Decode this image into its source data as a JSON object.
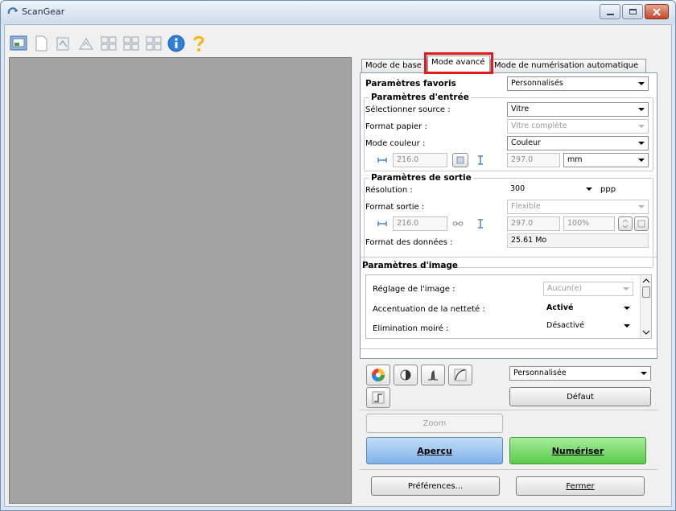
{
  "window": {
    "title": "ScanGear"
  },
  "tabs": [
    {
      "label": "Mode de base"
    },
    {
      "label": "Mode avancé"
    },
    {
      "label": "Mode de numérisation automatique"
    }
  ],
  "favorites": {
    "label": "Paramètres favoris",
    "value": "Personnalisés"
  },
  "input": {
    "section": "Paramètres d'entrée",
    "source_label": "Sélectionner source :",
    "source_value": "Vitre",
    "paper_label": "Format papier :",
    "paper_value": "Vitre complète",
    "color_label": "Mode couleur :",
    "color_value": "Couleur",
    "width": "216.0",
    "height": "297.0",
    "unit": "mm"
  },
  "output": {
    "section": "Paramètres de sortie",
    "resolution_label": "Résolution :",
    "resolution_value": "300",
    "resolution_unit": "ppp",
    "size_label": "Format sortie :",
    "size_value": "Flexible",
    "width": "216.0",
    "height": "297.0",
    "scale": "100%",
    "data_label": "Format des données :",
    "data_value": "25.61 Mo"
  },
  "image": {
    "section": "Paramètres d'image",
    "adjust_label": "Réglage de l'image :",
    "adjust_value": "Aucun(e)",
    "sharpen_label": "Accentuation de la netteté :",
    "sharpen_value": "Activé",
    "moire_label": "Elimination moiré :",
    "moire_value": "Désactivé"
  },
  "tone": {
    "preset": "Personnalisée",
    "default_button": "Défaut"
  },
  "buttons": {
    "zoom": "Zoom",
    "preview": "Aperçu",
    "scan": "Numériser",
    "preferences": "Préférences...",
    "close": "Fermer"
  },
  "colors": {
    "highlight": "#e31b1b",
    "preview_area": "#a3a3a3",
    "scan_button": "#5acb4a",
    "preview_button": "#7fb2ea"
  }
}
